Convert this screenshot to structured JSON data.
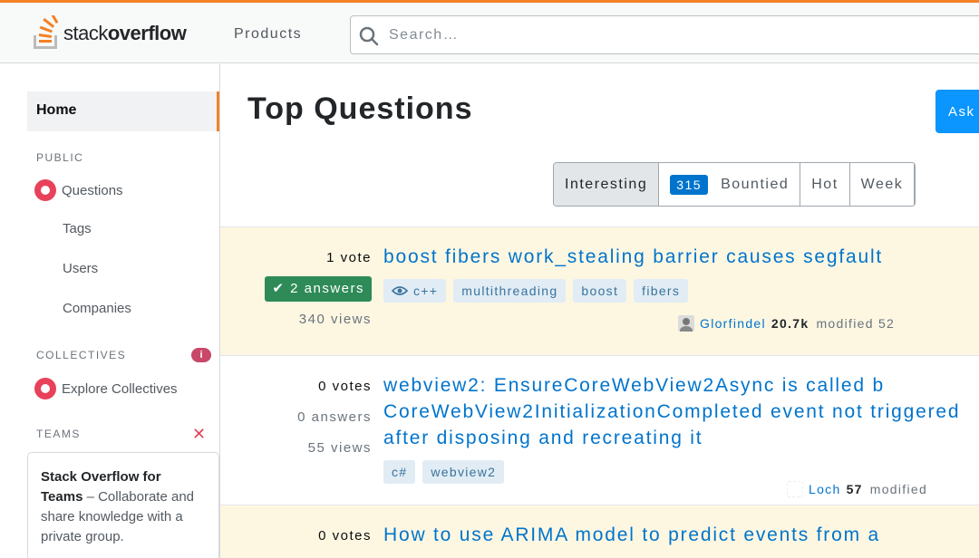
{
  "header": {
    "logo_text_regular": "stack",
    "logo_text_bold": "overflow",
    "products_label": "Products",
    "search_placeholder": "Search…"
  },
  "sidebar": {
    "home_label": "Home",
    "public_label": "PUBLIC",
    "questions_label": "Questions",
    "tags_label": "Tags",
    "users_label": "Users",
    "companies_label": "Companies",
    "collectives_label": "COLLECTIVES",
    "explore_collectives_label": "Explore Collectives",
    "teams_label": "TEAMS",
    "teams_box_title": "Stack Overflow for Teams",
    "teams_box_desc": " – Collaborate and share knowledge with a private group."
  },
  "main": {
    "title": "Top Questions",
    "ask_button_label": "Ask",
    "filters": {
      "interesting": "Interesting",
      "bounty_count": "315",
      "bountied": "Bountied",
      "hot": "Hot",
      "week": "Week"
    }
  },
  "questions": [
    {
      "votes": "1 vote",
      "answers": "2 answers",
      "views": "340 views",
      "title": "boost fibers work_stealing barrier causes segfault",
      "tags": [
        "c++",
        "multithreading",
        "boost",
        "fibers"
      ],
      "user": "Glorfindel",
      "rep": "20.7k",
      "action": "modified 52"
    },
    {
      "votes": "0 votes",
      "answers": "0 answers",
      "views": "55 views",
      "title": "webview2: EnsureCoreWebView2Async is called b CoreWebView2InitializationCompleted event not triggered after disposing and recreating it",
      "tags": [
        "c#",
        "webview2"
      ],
      "user": "Loch",
      "rep": "57",
      "action": "modified"
    },
    {
      "votes": "0 votes",
      "title": "How to use ARIMA model to predict events from a"
    }
  ]
}
